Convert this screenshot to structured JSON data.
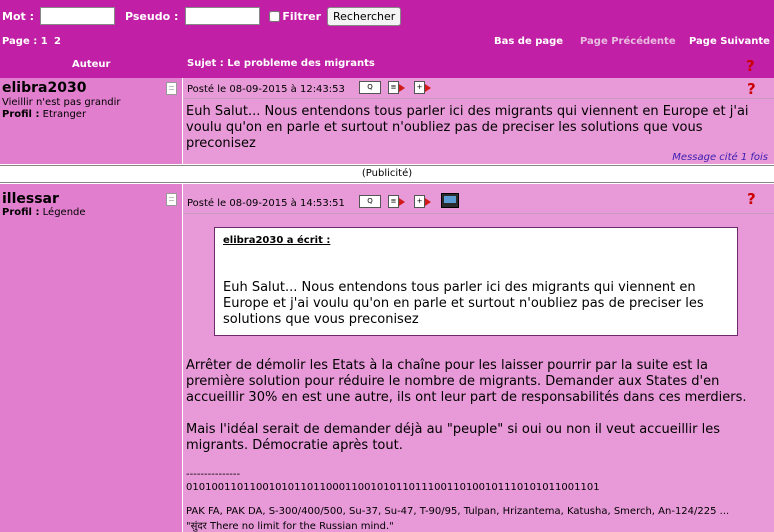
{
  "search": {
    "mot_label": "Mot :",
    "pseudo_label": "Pseudo :",
    "filtrer_label": "Filtrer",
    "button_label": "Rechercher",
    "mot_value": "",
    "pseudo_value": ""
  },
  "nav": {
    "page_label": "Page : 1",
    "page2": "2",
    "bas": "Bas de page",
    "prev": "Page Précédente",
    "next": "Page Suivante"
  },
  "header": {
    "auteur": "Auteur",
    "sujet": "Sujet : Le probleme des migrants"
  },
  "post1": {
    "author": "elibra2030",
    "subtitle": "Vieillir n'est pas grandir",
    "profil_label": "Profil :",
    "profil_value": "Etranger",
    "meta": "Posté le 08-09-2015 à 12:43:53",
    "body": "Euh Salut... Nous entendons tous parler ici des migrants qui viennent en Europe et j'ai voulu qu'on en parle et surtout n'oubliez pas de preciser les solutions que vous preconisez",
    "cited": "Message cité 1 fois"
  },
  "publicite": "(Publicité)",
  "post2": {
    "author": "illessar",
    "profil_label": "Profil :",
    "profil_value": "Légende",
    "meta": "Posté le 08-09-2015 à 14:53:51",
    "quote_author": "elibra2030 a écrit :",
    "quote_text": "Euh Salut... Nous entendons tous parler ici des migrants qui viennent en Europe et j'ai voulu qu'on en parle et surtout n'oubliez pas de preciser les solutions que vous preconisez",
    "para1": "Arrêter de démolir les Etats à la chaîne pour les laisser pourrir par la suite est la première solution pour réduire le nombre de migrants. Demander aux States d'en accueillir 30% en est une autre, ils ont leur part de responsabilités dans ces merdiers.",
    "para2": "Mais l'idéal serait de demander déjà au \"peuple\" si oui ou non il veut accueillir les migrants. Démocratie après tout.",
    "sig_dashes": "---------------",
    "sig_binary": "01010011011001010110110001100101011011100110100101110101011001101",
    "sig_line1": "PAK FA, PAK DA, S-300/400/500,  Su-37, Su-47, T-90/95, Tulpan, Hrizantema, Katusha, Smerch, An-124/225 ...",
    "sig_line2": "\"सुंदर There no limit for the Russian mind.\""
  },
  "colors": {
    "header_bg": "#c21fa7",
    "side_bg": "#e17ecd",
    "main_bg": "#e89ad8"
  },
  "icons": [
    "document-icon",
    "quote-icon",
    "edit-icon",
    "reply-icon",
    "monitor-icon",
    "alert-icon"
  ]
}
